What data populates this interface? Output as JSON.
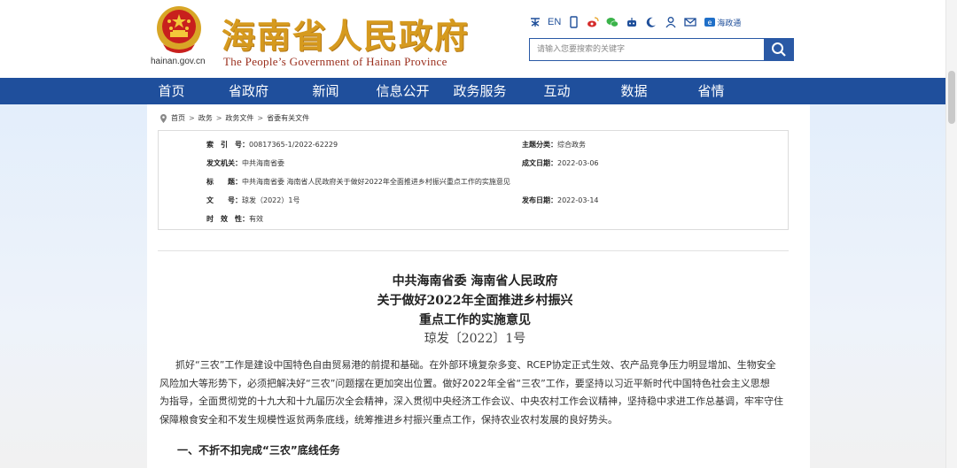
{
  "header": {
    "site_title_cn": "海南省人民政府",
    "site_title_en": "The People’s Government  of Hainan Province",
    "domain": "hainan.gov.cn",
    "tools": {
      "en_label": "EN",
      "app_label": "海政通"
    },
    "search": {
      "placeholder": "请输入您要搜索的关键字"
    }
  },
  "nav": {
    "items": [
      "首页",
      "省政府",
      "新闻",
      "信息公开",
      "政务服务",
      "互动",
      "数据",
      "省情"
    ]
  },
  "breadcrumb": {
    "items": [
      "首页",
      "政务",
      "政务文件",
      "省委有关文件"
    ],
    "separator": ">"
  },
  "meta": {
    "index_label": "索　引　号：",
    "index_value": "00817365-1/2022-62229",
    "category_label": "主题分类：",
    "category_value": "综合政务",
    "issuer_label": "发文机关：",
    "issuer_value": "中共海南省委",
    "created_label": "成文日期：",
    "created_value": "2022-03-06",
    "title_label": "标　　题：",
    "title_value": "中共海南省委 海南省人民政府关于做好2022年全面推进乡村振兴重点工作的实施意见",
    "docno_label": "文　　号：",
    "docno_value": "琼发（2022）1号",
    "published_label": "发布日期：",
    "published_value": "2022-03-14",
    "validity_label": "时　效　性：",
    "validity_value": "有效"
  },
  "document": {
    "title_lines": [
      "中共海南省委 海南省人民政府",
      "关于做好2022年全面推进乡村振兴",
      "重点工作的实施意见"
    ],
    "doc_number": "琼发〔2022〕1号",
    "paragraph_lines": [
      "抓好“三农”工作是建设中国特色自由贸易港的前提和基础。在外部环境复杂多变、RCEP协定正式生效、农产品竞争压力明显增加、生物安全",
      "风险加大等形势下，必须把解决好“三农”问题摆在更加突出位置。做好2022年全省“三农”工作，要坚持以习近平新时代中国特色社会主义思想",
      "为指导，全面贯彻党的十九大和十九届历次全会精神，深入贯彻中央经济工作会议、中央农村工作会议精神，坚持稳中求进工作总基调，牢牢守住",
      "保障粮食安全和不发生规模性返贫两条底线，统筹推进乡村振兴重点工作，保持农业农村发展的良好势头。"
    ],
    "section_heading": "一、不折不扣完成“三农”底线任务"
  },
  "colors": {
    "nav_bg": "#1f4f9c",
    "title_gold": "#d69a1e",
    "emblem_red": "#c8201d"
  }
}
